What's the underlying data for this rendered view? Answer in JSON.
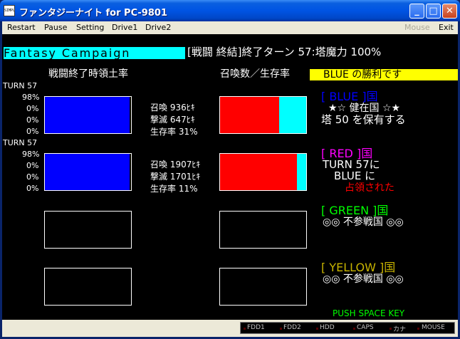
{
  "window": {
    "icon_text": "SIMPLE",
    "title": "ファンタジーナイト for PC-9801",
    "minimize": "_",
    "maximize": "□",
    "close": "✕"
  },
  "menu": {
    "items": [
      "Restart",
      "Pause",
      "Setting",
      "Drive1",
      "Drive2"
    ],
    "mouse": "Mouse",
    "exit": "Exit"
  },
  "game": {
    "header": {
      "title": "Fantasy Campaign",
      "status": "[戦闘 終結]終了ターン 57:塔魔力 100%"
    },
    "left_title": "戦闘終了時領土率",
    "mid_title": "召喚数／生存率",
    "winner_banner": "BLUE  の勝利です",
    "left_rows": [
      {
        "turn": "TURN 57",
        "pcts": [
          "98%",
          "0%",
          "0%",
          "0%"
        ],
        "fill": 0.98
      },
      {
        "turn": "TURN 57",
        "pcts": [
          "98%",
          "0%",
          "0%",
          "0%"
        ],
        "fill": 0.98
      },
      {
        "fill": 0
      },
      {
        "fill": 0
      }
    ],
    "stats": [
      {
        "summon": "召喚  936ﾋｷ",
        "kill": "撃滅  647ﾋｷ",
        "survival": "生存率 31%",
        "survival_fraction": 0.31
      },
      {
        "summon": "召喚 1907ﾋｷ",
        "kill": "撃滅 1701ﾋｷ",
        "survival": "生存率 11%",
        "survival_fraction": 0.11
      }
    ],
    "nations": {
      "blue": {
        "heading": "[ BLUE   ]国",
        "line1": "★☆  健在国  ☆★",
        "line2": "塔  50 を保有する"
      },
      "red": {
        "heading": "[ RED    ]国",
        "line1": "TURN 57に",
        "line2": "BLUE   に",
        "line3": "占領された"
      },
      "green": {
        "heading": "[ GREEN  ]国",
        "line1": "◎◎  不参戦国  ◎◎"
      },
      "yellow": {
        "heading": "[ YELLOW ]国",
        "line1": "◎◎  不参戦国  ◎◎"
      }
    },
    "prompt": "PUSH SPACE KEY"
  },
  "statusbar": {
    "items": [
      "FDD1",
      "FDD2",
      "HDD",
      "CAPS",
      "カナ",
      "MOUSE"
    ]
  },
  "colors": {
    "cyan": "#00ffff",
    "yellow": "#ffff00",
    "blue": "#0000ff",
    "red": "#ff0000",
    "magenta": "#ff00ff",
    "green": "#00ff00",
    "yellow_dim": "#c8b400"
  }
}
